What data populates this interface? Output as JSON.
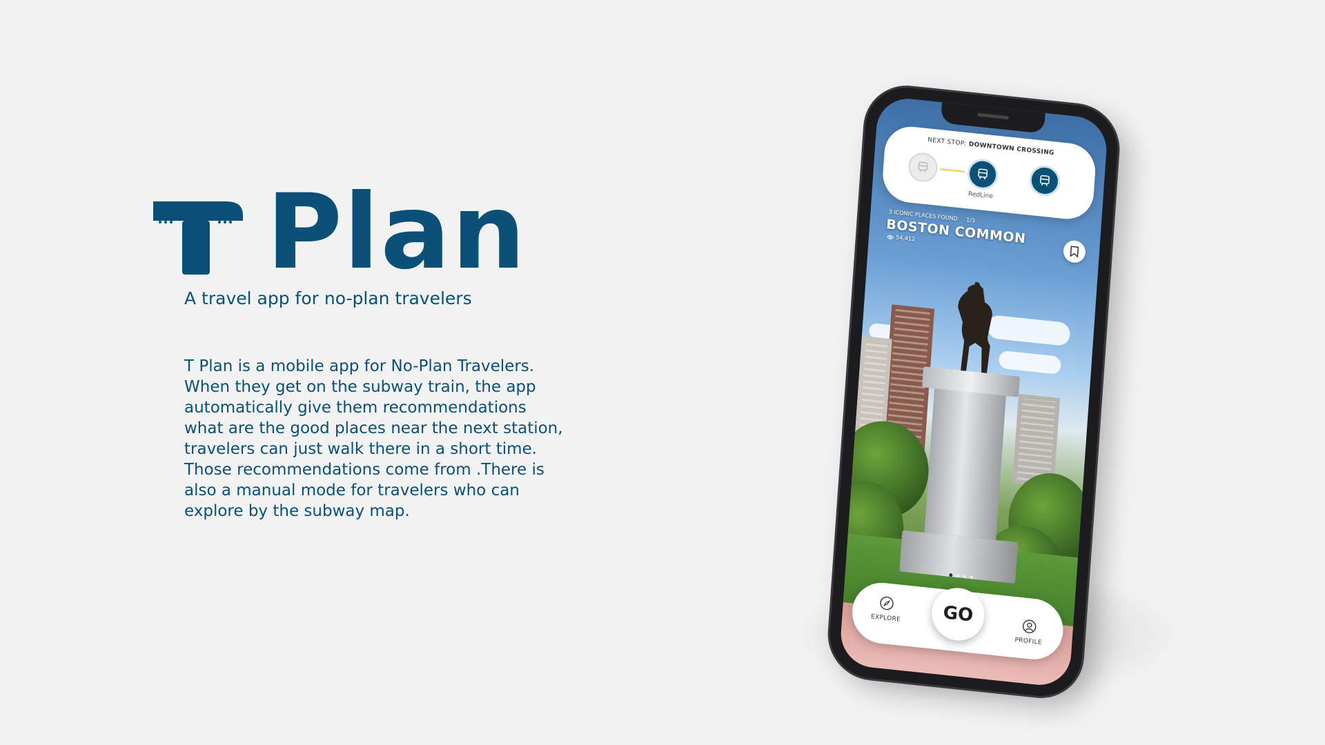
{
  "theme": {
    "brand": "#0b5077",
    "track_yellow": "#f2c94c"
  },
  "brand": {
    "title": "Plan",
    "logo_icon": "t-subway-logo-icon",
    "tagline": "A travel app for no-plan travelers"
  },
  "description": {
    "lines": [
      "T Plan is a mobile app for No-Plan Travelers.",
      "When they get on the subway train, the app",
      "automatically give them recommendations",
      "what are the good places near the next station,",
      "travelers can just walk there in a short time.",
      "Those recommendations come from .There is",
      "also a manual mode for travelers who can",
      "explore by the subway map."
    ]
  },
  "app": {
    "next_stop": {
      "prefix": "NEXT STOP:",
      "station": "DOWNTOWN CROSSING",
      "line_name": "RedLine",
      "station_icon": "train-icon"
    },
    "place": {
      "found_label": "3 ICONIC PLACES FOUND",
      "index": "1/3",
      "name": "BOSTON COMMON",
      "views": "54,412",
      "views_icon": "eye-icon",
      "bookmark_icon": "bookmark-icon"
    },
    "carousel": {
      "total": 4,
      "active": 1
    },
    "nav": {
      "explore_label": "EXPLORE",
      "explore_icon": "compass-icon",
      "go_label": "GO",
      "profile_label": "PROFILE",
      "profile_icon": "user-icon"
    }
  }
}
